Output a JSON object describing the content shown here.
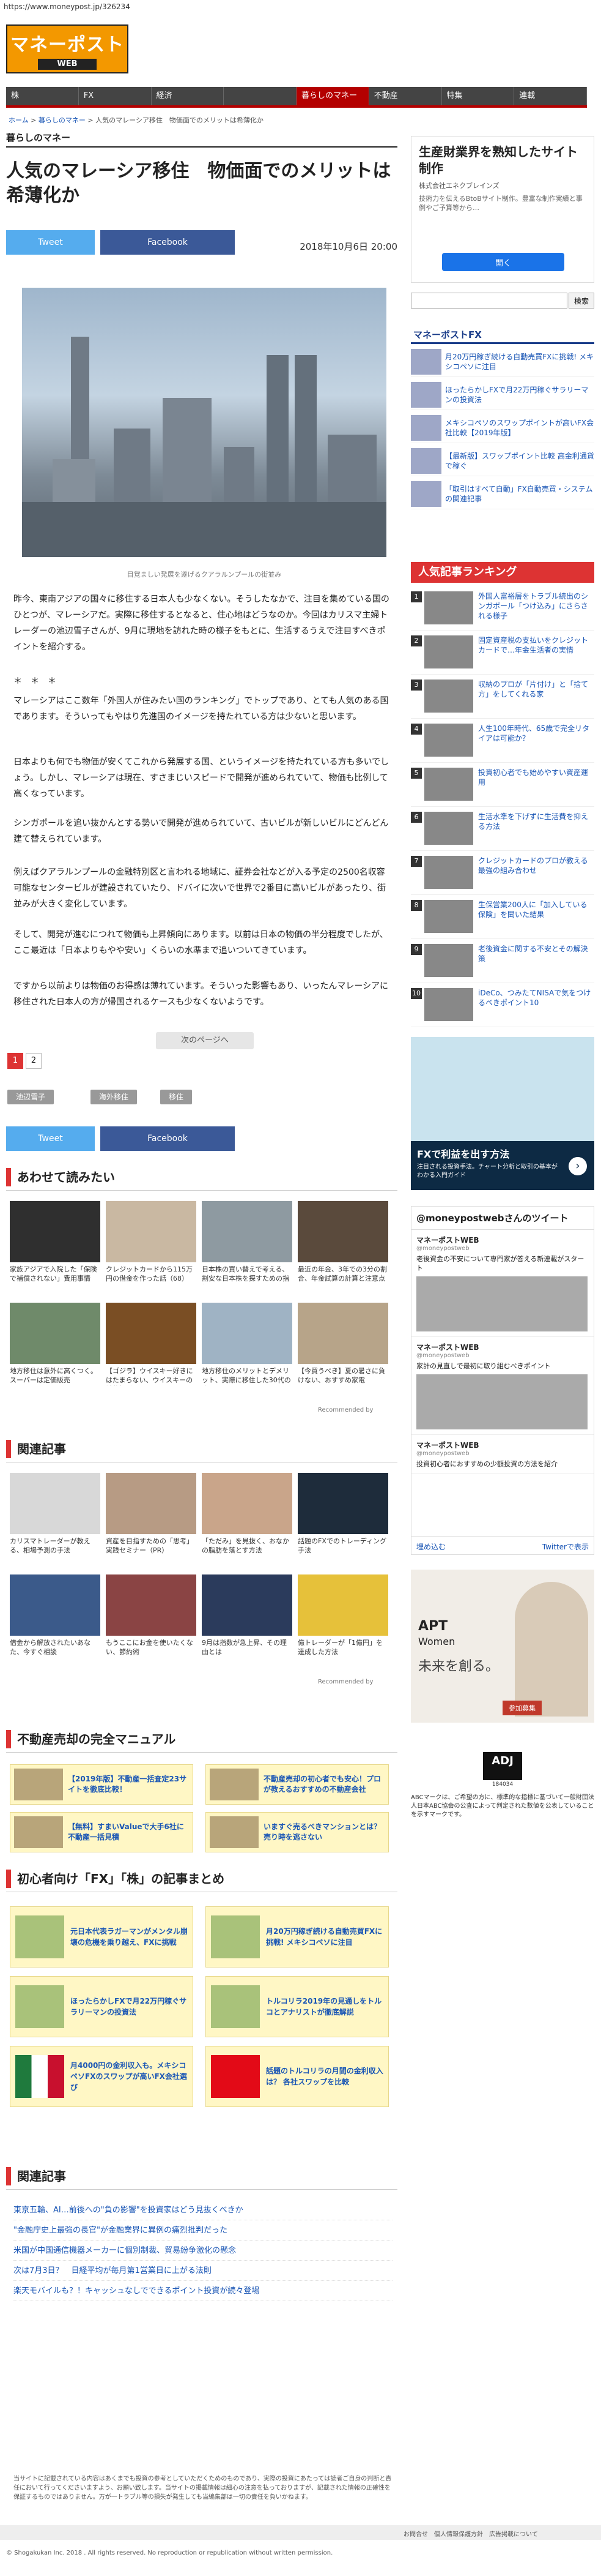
{
  "browser": {
    "url": "https://www.moneypost.jp/326234"
  },
  "logo": {
    "main": "マネーポスト",
    "sub": "WEB"
  },
  "nav": {
    "items": [
      "株",
      "FX",
      "経済",
      "",
      "暮らしのマネー",
      "不動産",
      "特集",
      "連載"
    ],
    "active_index": 4
  },
  "breadcrumb": [
    "ホーム",
    "暮らしのマネー",
    "人気のマレーシア移住　物価面でのメリットは希薄化か"
  ],
  "section_label": "暮らしのマネー",
  "article": {
    "title": "人気のマレーシア移住　物価面でのメリットは希薄化か",
    "tweet_label": "Tweet",
    "facebook_label": "Facebook",
    "date": "2018年10月6日 20:00",
    "photo_caption": "目覚ましい発展を遂げるクアラルンプールの街並み",
    "paragraphs": [
      "昨今、東南アジアの国々に移住する日本人も少なくない。そうしたなかで、注目を集めている国のひとつが、マレーシアだ。実際に移住するとなると、住心地はどうなのか。今回はカリスマ主婦トレーダーの池辺雪子さんが、9月に現地を訪れた時の様子をもとに、生活するうえで注目すべきポイントを紹介する。",
      "＊　＊　＊",
      "マレーシアはここ数年「外国人が住みたい国のランキング」でトップであり、とても人気のある国であります。そういってもやはり先進国のイメージを持たれている方は少ないと思います。",
      "日本よりも何でも物価が安くてこれから発展する国、というイメージを持たれている方も多いでしょう。しかし、マレーシアは現在、すさまじいスピードで開発が進められていて、物価も比例して高くなっています。",
      "シンガポールを追い抜かんとする勢いで開発が進められていて、古いビルが新しいビルにどんどん建て替えられています。",
      "例えばクアラルンプールの金融特別区と言われる地域に、証券会社などが入る予定の2500名収容可能なセンタービルが建設されていたり、ドバイに次いで世界で2番目に高いビルがあったり、街並みが大きく変化しています。",
      "そして、開発が進むにつれて物価も上昇傾向にあります。以前は日本の物価の半分程度でしたが、ここ最近は「日本よりもやや安い」くらいの水準まで追いついてきています。",
      "ですから以前よりは物価のお得感は薄れています。そういった影響もあり、いったんマレーシアに移住された日本人の方が帰国されるケースも少なくないようです。"
    ],
    "next_page_label": "次のページへ",
    "pages": [
      "1",
      "2"
    ],
    "tags": [
      "池辺雪子",
      "海外移住",
      "移住"
    ]
  },
  "recommend": {
    "heading": "あわせて読みたい",
    "items": [
      {
        "title": "家族アジアで入院した「保険で補償されない」費用事情"
      },
      {
        "title": "クレジットカードから115万円の借金を作った話（68）"
      },
      {
        "title": "日本株の買い替えで考える、割安な日本株を探すための指標"
      },
      {
        "title": "最近の年金、3年での3分の割合、年金試算の計算と注意点"
      },
      {
        "title": "地方移住は意外に高くつく。スーパーは定価販売"
      },
      {
        "title": "【ゴジラ】ウイスキー好きにはたまらない、ウイスキーの試飲場所"
      },
      {
        "title": "地方移住のメリットとデメリット、実際に移住した30代の声"
      },
      {
        "title": "【今買うべき】夏の暑さに負けない、おすすめ家電"
      }
    ],
    "recommended_by": "Recommended by"
  },
  "related_ads": {
    "heading": "関連記事",
    "items": [
      {
        "title": "カリスマトレーダーが教える、相場予測の手法"
      },
      {
        "title": "資産を目指すための「思考」実践セミナー（PR）"
      },
      {
        "title": "「ただみ」を見抜く、おなかの脂肪を落とす方法"
      },
      {
        "title": "話題のFXでのトレーディング手法"
      },
      {
        "title": "借金から解放されたいあなた、今すぐ相談"
      },
      {
        "title": "もうここにお金を使いたくない、節約術"
      },
      {
        "title": "9月は指数が急上昇、その理由とは"
      },
      {
        "title": "億トレーダーが「1億円」を達成した方法"
      }
    ],
    "recommended_by": "Recommended by"
  },
  "realestate": {
    "heading": "不動産売却の完全マニュアル",
    "items": [
      {
        "title": "【2019年版】不動産一括査定23サイトを徹底比較！"
      },
      {
        "title": "不動産売却の初心者でも安心！プロが教えるおすすめの不動産会社"
      },
      {
        "title": "【無料】すまいValueで大手6社に不動産一括見積"
      },
      {
        "title": "いますぐ売るべきマンションとは？売り時を逃さない"
      }
    ]
  },
  "beginner_fx": {
    "heading": "初心者向け「FX」「株」の記事まとめ",
    "items": [
      {
        "title": "元日本代表ラガーマンがメンタル崩壊の危機を乗り越え、FXに挑戦"
      },
      {
        "title": "月20万円稼ぎ続ける自動売買FXに挑戦! メキシコペソに注目"
      },
      {
        "title": "ほったらかしFXで月22万円稼ぐサラリーマンの投資法"
      },
      {
        "title": "トルコリラ2019年の見通しをトルコとアナリストが徹底解説"
      },
      {
        "title": "月4000円の金利収入も。メキシコペソFXのスワップが高いFX会社選び"
      },
      {
        "title": "話題のトルコリラの月間の金利収入は？ 各社スワップを比較"
      }
    ]
  },
  "related_list": {
    "heading": "関連記事",
    "items": [
      "東京五輪、AI…前後への\"負の影響\"を投資家はどう見抜くべきか",
      "\"金融庁史上最強の長官\"が金融業界に異例の痛烈批判だった",
      "米国が中国通信機器メーカーに個別制裁、貿易紛争激化の懸念",
      "次は7月3日？　日経平均が毎月第1営業日に上がる法則",
      "楽天モバイルも？！キャッシュなしでできるポイント投資が続々登場"
    ]
  },
  "disclaimer": "当サイトに記載されている内容はあくまでも投資の参考としていただくためのものであり、実際の投資にあたっては読者ご自身の判断と責任において行ってくださいますよう、お願い致します。当サイトの掲載情報は細心の注意を払っておりますが、記載された情報の正確性を保証するものではありません。万が一トラブル等の損失が発生しても当編集部は一切の責任を負いかねます。",
  "footer": {
    "links": "お問合せ　個人情報保護方針　広告掲載について",
    "copyright": "© Shogakukan Inc. 2018 . All rights reserved. No reproduction or republication without written permission."
  },
  "sidebar": {
    "ad": {
      "title": "生産財業界を熟知したサイト制作",
      "company": "株式会社エネクブレインズ",
      "desc": "技術力を伝えるBtoBサイト制作。豊富な制作実績と事例やご予算等から…",
      "button": "開く"
    },
    "search": {
      "placeholder": "",
      "button": "検索"
    },
    "fx_heading": "マネーポストFX",
    "fx_items": [
      "月20万円稼ぎ続ける自動売買FXに挑戦! メキシコペソに注目",
      "ほったらかしFXで月22万円稼ぐサラリーマンの投資法",
      "メキシコペソのスワップポイントが高いFX会社比較【2019年版】",
      "【最新版】スワップポイント比較 高金利通貨で稼ぐ",
      "「取引はすべて自動」FX自動売買・システムの関連記事"
    ],
    "ranking_heading": "人気記事ランキング",
    "ranking": [
      "外国人富裕層をトラブル続出のシンガポール「つけ込み」にさらされる様子",
      "固定資産税の支払いをクレジットカードで…年金生活者の実情",
      "収納のプロが「片付け」と「捨て方」をしてくれる家",
      "人生100年時代、65歳で完全リタイアは可能か？",
      "投資初心者でも始めやすい資産運用",
      "生活水準を下げずに生活費を抑える方法",
      "クレジットカードのプロが教える最強の組み合わせ",
      "生保営業200人に「加入している保険」を聞いた結果",
      "老後資金に関する不安とその解決策",
      "iDeCo、つみたてNISAで気をつけるべきポイント10"
    ],
    "ad2": {
      "title": "FXで利益を出す方法",
      "desc": "注目される投資手法。チャート分析と取引の基本がわかる入門ガイド",
      "arrow": "›"
    },
    "twitter": {
      "heading": "@moneypostwebさんのツイート",
      "tweets": [
        {
          "name": "マネーポストWEB",
          "handle": "@moneypostweb",
          "text": "老後資金の不安について専門家が答える新連載がスタート"
        },
        {
          "name": "マネーポストWEB",
          "handle": "@moneypostweb",
          "text": "家計の見直しで最初に取り組むべきポイント"
        },
        {
          "name": "マネーポストWEB",
          "handle": "@moneypostweb",
          "text": "投資初心者におすすめの少額投資の方法を紹介"
        }
      ],
      "embed_label": "埋め込む",
      "view_label": "Twitterで表示"
    },
    "ad3": {
      "brand": "APT",
      "sub": "Women",
      "tagline": "未来を創る。",
      "button": "参加募集"
    },
    "adj": {
      "label": "ADJ",
      "number": "184034"
    },
    "adj_text": "ABCマークは、ご希望の方に、標準的な指標に基づいて一般財団法人日本ABC協会の公査によって判定された数値を公表していることを示すマークです。"
  }
}
